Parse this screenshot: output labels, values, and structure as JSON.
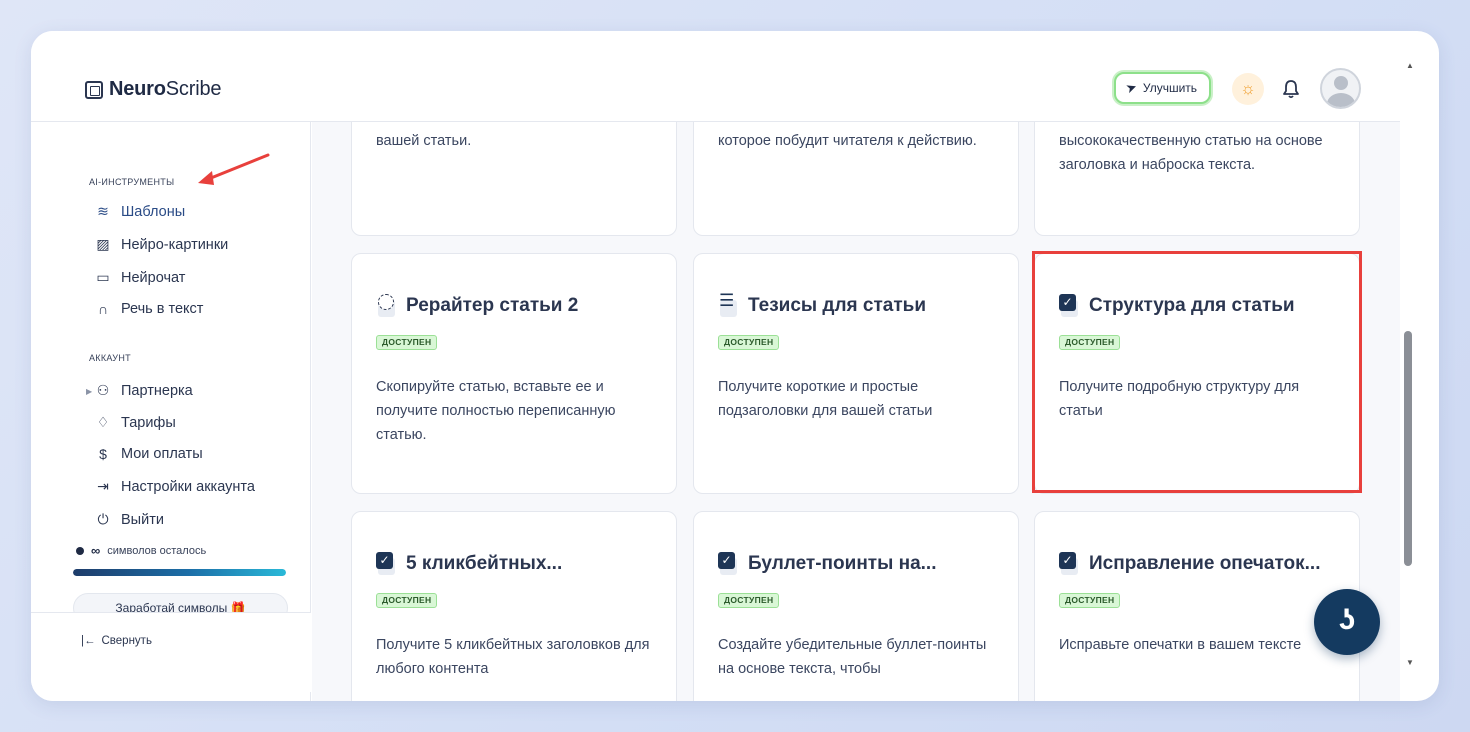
{
  "app": {
    "logo_bold": "Neuro",
    "logo_rest": "Scribe"
  },
  "header": {
    "upgrade_label": "Улучшить"
  },
  "sidebar": {
    "section_tools": "AI-ИНСТРУМЕНТЫ",
    "tools": [
      {
        "label": "Шаблоны",
        "icon": "layers-icon"
      },
      {
        "label": "Нейро-картинки",
        "icon": "image-icon"
      },
      {
        "label": "Нейрочат",
        "icon": "chat-icon"
      },
      {
        "label": "Речь в текст",
        "icon": "headphones-icon"
      }
    ],
    "section_account": "АККАУНТ",
    "account": [
      {
        "label": "Партнерка",
        "icon": "users-icon"
      },
      {
        "label": "Тарифы",
        "icon": "tag-icon"
      },
      {
        "label": "Мои оплаты",
        "icon": "dollar-icon"
      },
      {
        "label": "Настройки аккаунта",
        "icon": "login-icon"
      },
      {
        "label": "Выйти",
        "icon": "power-icon"
      }
    ],
    "credits_symbol": "∞",
    "credits_text": "символов осталось",
    "credits_progress": 1.0,
    "earn_label": "Заработай символы 🎁",
    "collapse_label": "Свернуть"
  },
  "cards_top": [
    {
      "desc": "вашей статьи."
    },
    {
      "desc": "которое побудит читателя к действию."
    },
    {
      "desc": "высококачественную статью на основе заголовка и наброска текста."
    }
  ],
  "cards_mid": [
    {
      "title": "Рерайтер статьи 2",
      "badge": "ДОСТУПЕН",
      "desc": "Скопируйте статью, вставьте ее и получите полностью переписанную статью."
    },
    {
      "title": "Тезисы для статьи",
      "badge": "ДОСТУПЕН",
      "desc": "Получите короткие и простые подзаголовки для вашей статьи"
    },
    {
      "title": "Структура для статьи",
      "badge": "ДОСТУПЕН",
      "desc": "Получите подробную структуру для статьи"
    }
  ],
  "cards_bottom": [
    {
      "title": "5 кликбейтных...",
      "badge": "ДОСТУПЕН",
      "desc": "Получите 5 кликбейтных заголовков для любого контента"
    },
    {
      "title": "Буллет-поинты на...",
      "badge": "ДОСТУПЕН",
      "desc": "Создайте убедительные буллет-поинты на основе текста, чтобы"
    },
    {
      "title": "Исправление опечаток...",
      "badge": "ДОСТУПЕН",
      "desc": "Исправьте опечатки в вашем тексте"
    }
  ],
  "chat_button_glyph": "ʖ",
  "colors": {
    "accent": "#143a60",
    "highlight": "#e8403c",
    "badge_bg": "#d9f7d6"
  }
}
